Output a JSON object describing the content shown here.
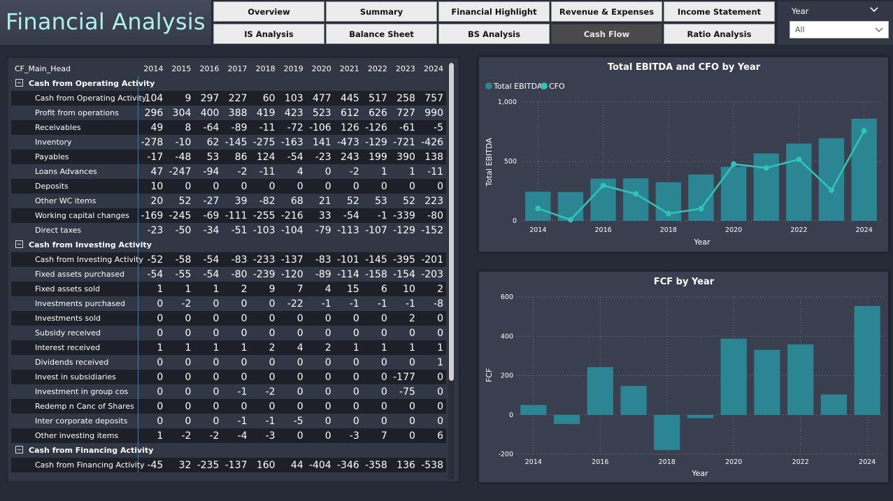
{
  "header": {
    "title": "Financial Analysis"
  },
  "nav": {
    "buttons": [
      {
        "label": "Overview"
      },
      {
        "label": "Summary"
      },
      {
        "label": "Financial Highlight"
      },
      {
        "label": "Revenue & Expenses"
      },
      {
        "label": "Income Statement"
      },
      {
        "label": "IS Analysis"
      },
      {
        "label": "Balance Sheet"
      },
      {
        "label": "BS Analysis"
      },
      {
        "label": "Cash Flow",
        "active": true
      },
      {
        "label": "Ratio Analysis"
      }
    ]
  },
  "filter": {
    "label": "Year",
    "selected": "All"
  },
  "table": {
    "head_label": "CF_Main_Head",
    "years": [
      "2014",
      "2015",
      "2016",
      "2017",
      "2018",
      "2019",
      "2020",
      "2021",
      "2022",
      "2023",
      "2024"
    ],
    "rows": [
      {
        "name": "Cash from Operating Activity",
        "group": true,
        "values": []
      },
      {
        "name": "Cash from Operating Activity",
        "values": [
          "104",
          "9",
          "297",
          "227",
          "60",
          "103",
          "477",
          "445",
          "517",
          "258",
          "757"
        ]
      },
      {
        "name": "Profit from operations",
        "values": [
          "296",
          "304",
          "400",
          "388",
          "419",
          "423",
          "523",
          "612",
          "626",
          "727",
          "990"
        ]
      },
      {
        "name": "Receivables",
        "values": [
          "49",
          "8",
          "-64",
          "-89",
          "-11",
          "-72",
          "-106",
          "126",
          "-126",
          "-61",
          "-5"
        ]
      },
      {
        "name": "Inventory",
        "values": [
          "-278",
          "-10",
          "62",
          "-145",
          "-275",
          "-163",
          "141",
          "-473",
          "-129",
          "-721",
          "-426"
        ]
      },
      {
        "name": "Payables",
        "values": [
          "-17",
          "-48",
          "53",
          "86",
          "124",
          "-54",
          "-23",
          "243",
          "199",
          "390",
          "138"
        ]
      },
      {
        "name": "Loans Advances",
        "values": [
          "47",
          "-247",
          "-94",
          "-2",
          "-11",
          "4",
          "0",
          "-2",
          "1",
          "1",
          "-11"
        ]
      },
      {
        "name": "Deposits",
        "values": [
          "10",
          "0",
          "0",
          "0",
          "0",
          "0",
          "0",
          "0",
          "0",
          "0",
          "0"
        ]
      },
      {
        "name": "Other WC items",
        "values": [
          "20",
          "52",
          "-27",
          "39",
          "-82",
          "68",
          "21",
          "52",
          "53",
          "52",
          "223"
        ]
      },
      {
        "name": "Working capital changes",
        "values": [
          "-169",
          "-245",
          "-69",
          "-111",
          "-255",
          "-216",
          "33",
          "-54",
          "-1",
          "-339",
          "-80"
        ]
      },
      {
        "name": "Direct taxes",
        "values": [
          "-23",
          "-50",
          "-34",
          "-51",
          "-103",
          "-104",
          "-79",
          "-113",
          "-107",
          "-129",
          "-152"
        ]
      },
      {
        "name": "Cash from Investing Activity",
        "group": true,
        "values": []
      },
      {
        "name": "Cash from Investing Activity",
        "values": [
          "-52",
          "-58",
          "-54",
          "-83",
          "-233",
          "-137",
          "-83",
          "-101",
          "-145",
          "-395",
          "-201"
        ]
      },
      {
        "name": "Fixed assets purchased",
        "values": [
          "-54",
          "-55",
          "-54",
          "-80",
          "-239",
          "-120",
          "-89",
          "-114",
          "-158",
          "-154",
          "-203"
        ]
      },
      {
        "name": "Fixed assets sold",
        "values": [
          "1",
          "1",
          "1",
          "2",
          "9",
          "7",
          "4",
          "15",
          "6",
          "10",
          "2"
        ]
      },
      {
        "name": "Investments purchased",
        "values": [
          "0",
          "-2",
          "0",
          "0",
          "0",
          "-22",
          "-1",
          "-1",
          "-1",
          "-1",
          "-8"
        ]
      },
      {
        "name": "Investments sold",
        "values": [
          "0",
          "0",
          "0",
          "0",
          "0",
          "0",
          "0",
          "0",
          "0",
          "2",
          "0"
        ]
      },
      {
        "name": "Subsidy received",
        "values": [
          "0",
          "0",
          "0",
          "0",
          "0",
          "0",
          "0",
          "0",
          "0",
          "0",
          "0"
        ]
      },
      {
        "name": "Interest received",
        "values": [
          "1",
          "1",
          "1",
          "1",
          "2",
          "4",
          "2",
          "1",
          "1",
          "1",
          "1"
        ]
      },
      {
        "name": "Dividends received",
        "values": [
          "0",
          "0",
          "0",
          "0",
          "0",
          "0",
          "0",
          "0",
          "0",
          "0",
          "1"
        ]
      },
      {
        "name": "Invest in subsidiaries",
        "values": [
          "0",
          "0",
          "0",
          "0",
          "0",
          "0",
          "0",
          "0",
          "0",
          "-177",
          "0"
        ]
      },
      {
        "name": "Investment in group cos",
        "values": [
          "0",
          "0",
          "0",
          "-1",
          "-2",
          "0",
          "0",
          "0",
          "0",
          "-75",
          "0"
        ]
      },
      {
        "name": "Redemp n Canc of Shares",
        "values": [
          "0",
          "0",
          "0",
          "0",
          "0",
          "0",
          "0",
          "0",
          "0",
          "0",
          "0"
        ]
      },
      {
        "name": "Inter corporate deposits",
        "values": [
          "0",
          "0",
          "0",
          "-1",
          "-1",
          "-5",
          "0",
          "0",
          "0",
          "0",
          "0"
        ]
      },
      {
        "name": "Other investing items",
        "values": [
          "1",
          "-2",
          "-2",
          "-4",
          "-3",
          "0",
          "0",
          "-3",
          "7",
          "0",
          "6"
        ]
      },
      {
        "name": "Cash from Financing Activity",
        "group": true,
        "values": []
      },
      {
        "name": "Cash from Financing Activity",
        "values": [
          "-45",
          "32",
          "-235",
          "-137",
          "160",
          "44",
          "-404",
          "-346",
          "-358",
          "136",
          "-538"
        ]
      }
    ]
  },
  "colors": {
    "bar": "#2c8593",
    "line": "#2ec4b6",
    "grid": "#6f7585"
  },
  "chart_data": [
    {
      "type": "bar",
      "title": "Total EBITDA and CFO by Year",
      "xlabel": "Year",
      "ylabel": "Total EBITDA",
      "legend_position": "top-left",
      "grid": true,
      "x": [
        2014,
        2015,
        2016,
        2017,
        2018,
        2019,
        2020,
        2021,
        2022,
        2023,
        2024
      ],
      "x_tick_labels": [
        "2014",
        "2016",
        "2018",
        "2020",
        "2022",
        "2024"
      ],
      "y_tick_labels": [
        "0",
        "500",
        "1,000"
      ],
      "ylim": [
        0,
        1000
      ],
      "series": [
        {
          "name": "Total EBITDA",
          "type": "bar",
          "values": [
            245,
            243,
            355,
            357,
            325,
            390,
            455,
            567,
            650,
            695,
            860
          ]
        },
        {
          "name": "CFO",
          "type": "line",
          "values": [
            104,
            9,
            297,
            227,
            60,
            103,
            477,
            445,
            517,
            258,
            757
          ]
        }
      ]
    },
    {
      "type": "bar",
      "title": "FCF by Year",
      "xlabel": "Year",
      "ylabel": "FCF",
      "grid": true,
      "x": [
        2014,
        2015,
        2016,
        2017,
        2018,
        2019,
        2020,
        2021,
        2022,
        2023,
        2024
      ],
      "x_tick_labels": [
        "2014",
        "2016",
        "2018",
        "2020",
        "2022",
        "2024"
      ],
      "y_tick_labels": [
        "-200",
        "0",
        "200",
        "400",
        "600"
      ],
      "ylim": [
        -200,
        600
      ],
      "series": [
        {
          "name": "FCF",
          "values": [
            50,
            -46,
            243,
            147,
            -179,
            -17,
            388,
            331,
            359,
            104,
            554
          ]
        }
      ]
    }
  ]
}
